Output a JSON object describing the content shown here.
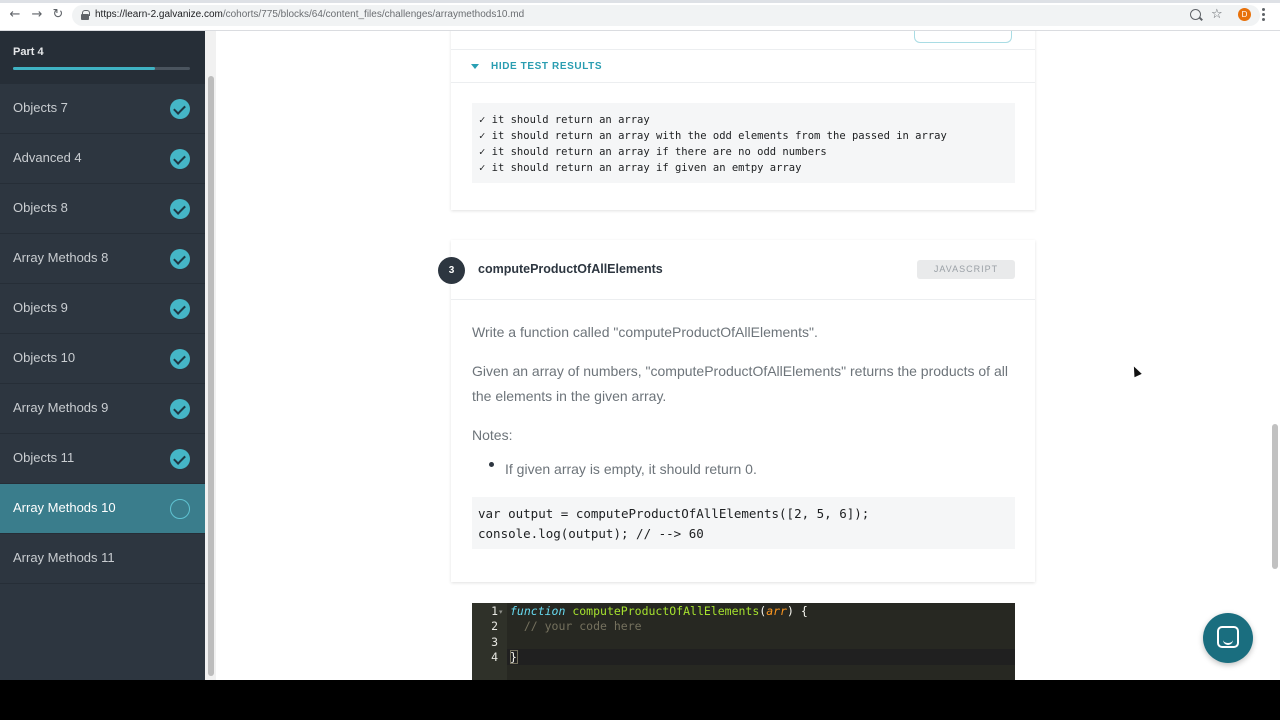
{
  "browser": {
    "url_host": "https://learn-2.galvanize.com",
    "url_path": "/cohorts/775/blocks/64/content_files/challenges/arraymethods10.md",
    "profile_initial": "D"
  },
  "sidebar": {
    "part_label": "Part 4",
    "progress_percent": 80,
    "items": [
      {
        "label": "Objects 7",
        "status": "complete"
      },
      {
        "label": "Advanced 4",
        "status": "complete"
      },
      {
        "label": "Objects 8",
        "status": "complete"
      },
      {
        "label": "Array Methods 8",
        "status": "complete"
      },
      {
        "label": "Objects 9",
        "status": "complete"
      },
      {
        "label": "Objects 10",
        "status": "complete"
      },
      {
        "label": "Array Methods 9",
        "status": "complete"
      },
      {
        "label": "Objects 11",
        "status": "complete"
      },
      {
        "label": "Array Methods 10",
        "status": "in-progress"
      },
      {
        "label": "Array Methods 11",
        "status": "none"
      }
    ]
  },
  "test_results": {
    "toggle_label": "HIDE TEST RESULTS",
    "lines": [
      "✓ it should return an array",
      "✓ it should return an array with the odd elements from the passed in array",
      "✓ it should return an array if there are no odd numbers",
      "✓ it should return an array if given an emtpy array"
    ]
  },
  "challenge": {
    "number": "3",
    "title": "computeProductOfAllElements",
    "language": "JAVASCRIPT",
    "paragraph1": "Write a function called \"computeProductOfAllElements\".",
    "paragraph2": "Given an array of numbers, \"computeProductOfAllElements\" returns the products of all the elements in the given array.",
    "notes_label": "Notes:",
    "note_items": [
      "If given array is empty, it should return 0."
    ],
    "example_lines": [
      "var output = computeProductOfAllElements([2, 5, 6]);",
      "console.log(output); // --> 60"
    ]
  },
  "editor": {
    "line_numbers": [
      "1",
      "2",
      "3",
      "4"
    ],
    "line1": {
      "keyword": "function",
      "name": "computeProductOfAllElements",
      "open": "(",
      "param": "arr",
      "close": ") {"
    },
    "line2_comment": "  // your code here",
    "line4": "}"
  },
  "colors": {
    "sidebar_bg": "#2d3640",
    "accent": "#3fb2c3",
    "active_item": "#3a7d8c",
    "chat_button": "#1a6e7f"
  }
}
